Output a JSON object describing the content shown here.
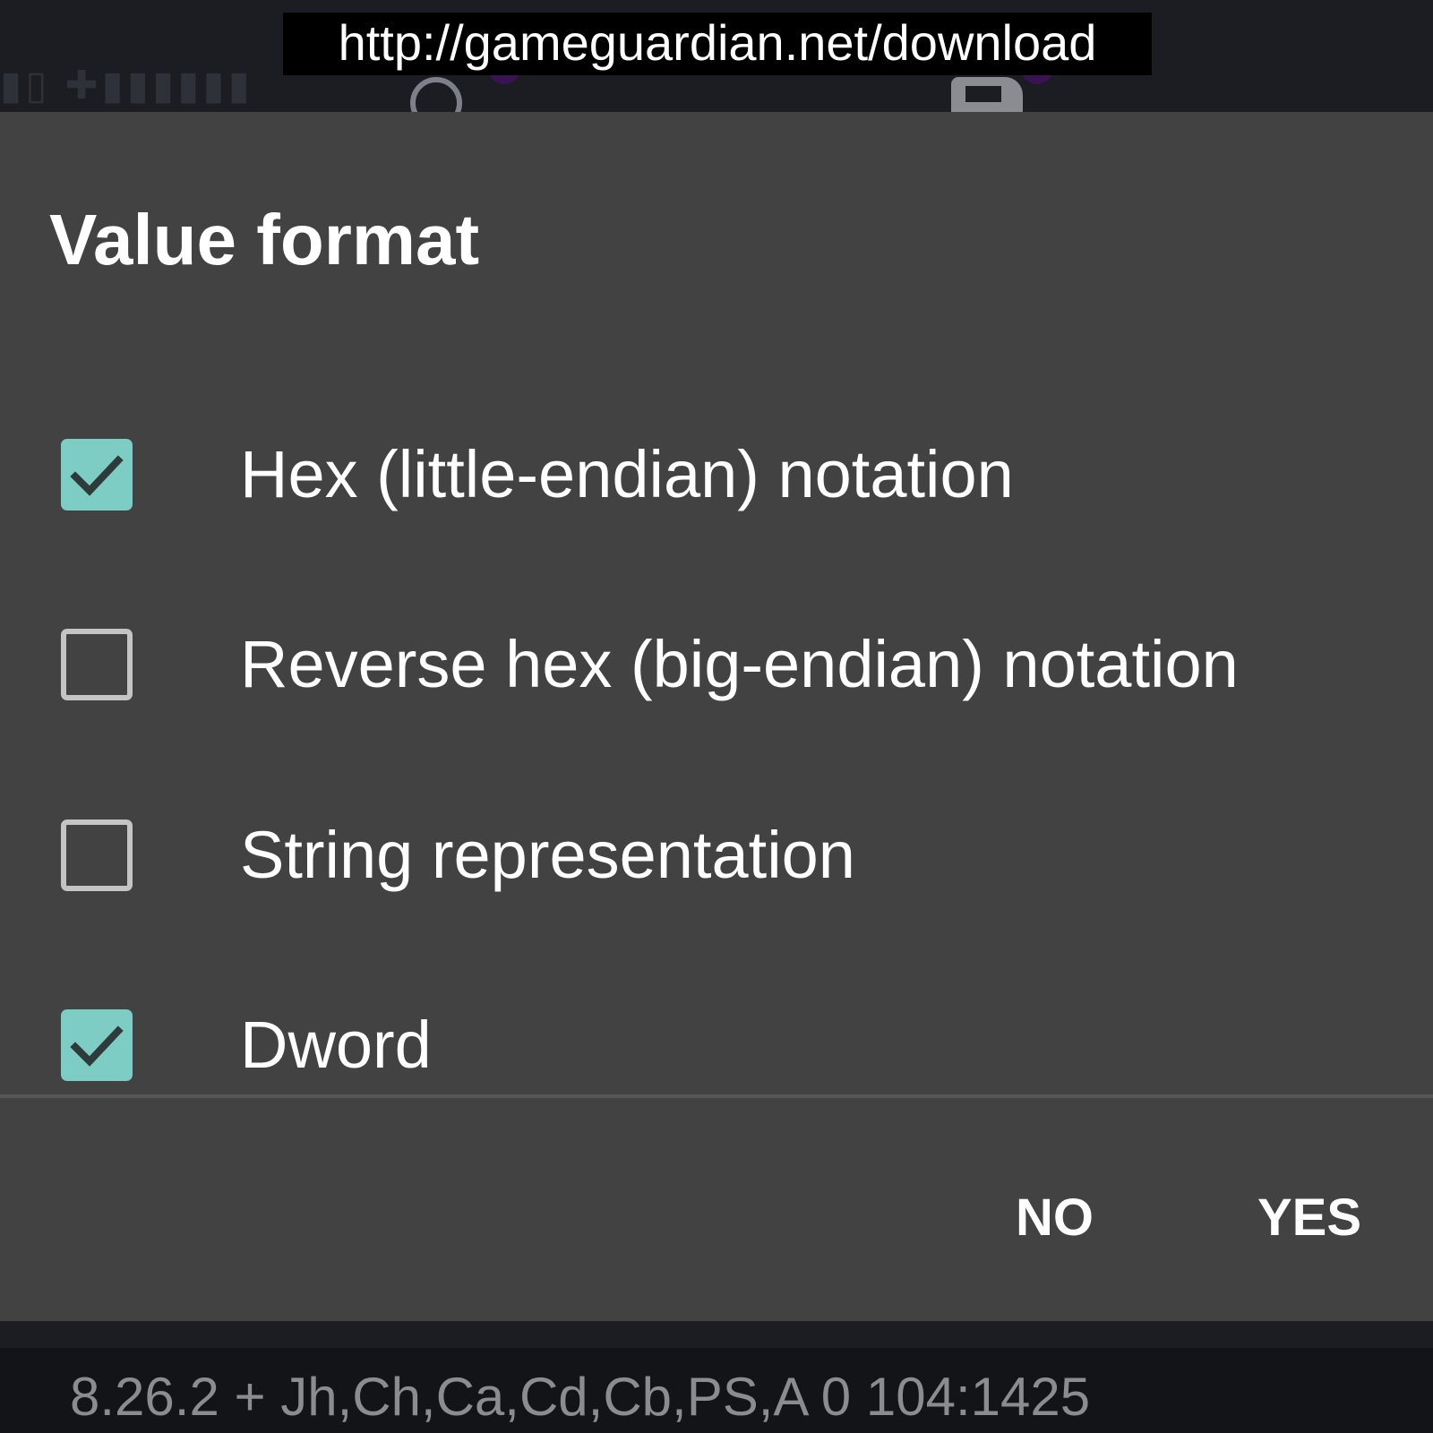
{
  "banner": {
    "url": "http://gameguardian.net/download"
  },
  "dialog": {
    "title": "Value format",
    "options": [
      {
        "label": "Hex (little-endian) notation",
        "checked": true
      },
      {
        "label": "Reverse hex (big-endian) notation",
        "checked": false
      },
      {
        "label": "String representation",
        "checked": false
      },
      {
        "label": "Dword",
        "checked": true
      }
    ],
    "no_label": "NO",
    "yes_label": "YES"
  },
  "status_bar": {
    "text": "8.26.2  +  Jh,Ch,Ca,Cd,Cb,PS,A   0  104:1425"
  },
  "colors": {
    "dialog_bg": "#424242",
    "checkbox_checked": "#7ecdc4",
    "checkbox_unchecked_border": "#c4c4c4",
    "check_mark": "#2f3a3a"
  },
  "icons": {
    "checked": "checkmark-icon",
    "background_search": "search-icon",
    "background_save": "save-icon"
  }
}
